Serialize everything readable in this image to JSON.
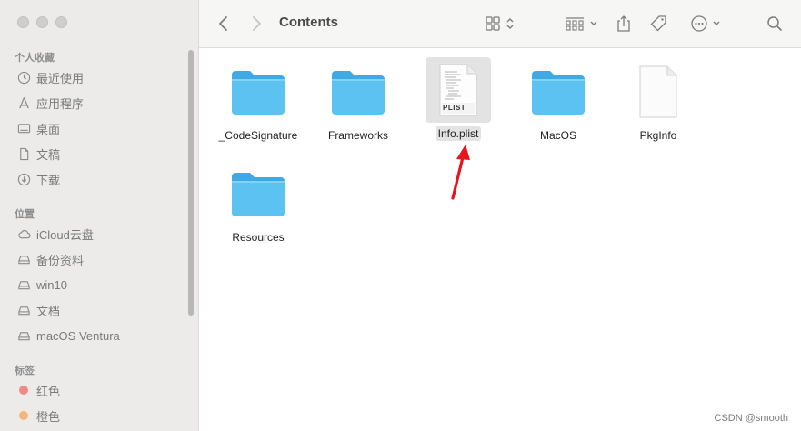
{
  "sidebar": {
    "favorites_header": "个人收藏",
    "favorites": [
      {
        "label": "最近使用",
        "icon": "clock-icon"
      },
      {
        "label": "应用程序",
        "icon": "applications-icon"
      },
      {
        "label": "桌面",
        "icon": "desktop-icon"
      },
      {
        "label": "文稿",
        "icon": "document-icon"
      },
      {
        "label": "下载",
        "icon": "download-icon"
      }
    ],
    "locations_header": "位置",
    "locations": [
      {
        "label": "iCloud云盘",
        "icon": "cloud-icon"
      },
      {
        "label": "备份资料",
        "icon": "drive-icon"
      },
      {
        "label": "win10",
        "icon": "drive-icon"
      },
      {
        "label": "文档",
        "icon": "drive-icon"
      },
      {
        "label": "macOS Ventura",
        "icon": "drive-icon"
      }
    ],
    "tags_header": "标签",
    "tags": [
      {
        "label": "红色",
        "color": "#f08a84"
      },
      {
        "label": "橙色",
        "color": "#f2b877"
      }
    ]
  },
  "toolbar": {
    "title": "Contents"
  },
  "files": [
    {
      "name": "_CodeSignature",
      "type": "folder"
    },
    {
      "name": "Frameworks",
      "type": "folder"
    },
    {
      "name": "Info.plist",
      "type": "plist",
      "badge": "PLIST",
      "selected": true
    },
    {
      "name": "MacOS",
      "type": "folder"
    },
    {
      "name": "PkgInfo",
      "type": "file"
    },
    {
      "name": "Resources",
      "type": "folder"
    }
  ],
  "colors": {
    "folder": "#5bc2f2",
    "arrow": "#e8141e"
  },
  "watermark": "CSDN @smooth"
}
